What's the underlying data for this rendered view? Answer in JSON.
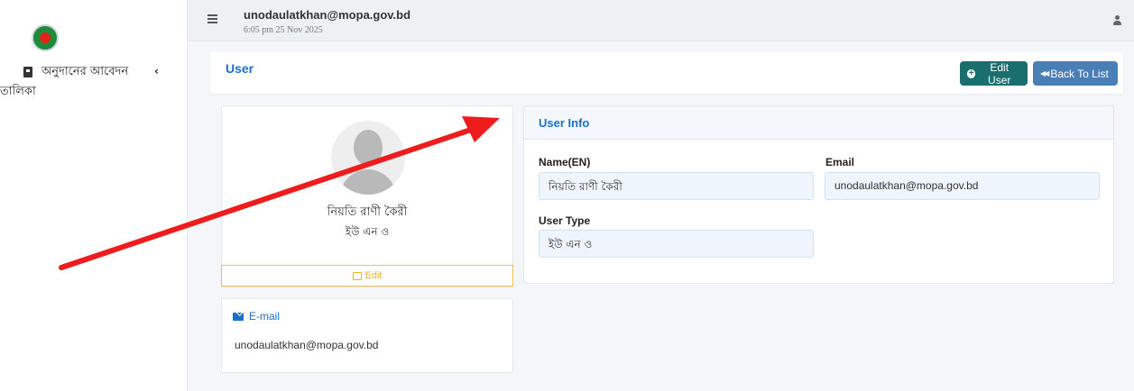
{
  "sidebar": {
    "menu_item": {
      "label_line1": "অনুদানের আবেদন",
      "label_line2": "তালিকা",
      "chevron": "‹"
    }
  },
  "topbar": {
    "user_email": "unodaulatkhan@mopa.gov.bd",
    "timestamp": "6:05 pm 25 Nov 2025"
  },
  "header": {
    "title": "User",
    "edit_user_label": "Edit User",
    "back_label": "Back To List"
  },
  "profile": {
    "name": "নিয়তি রাণী কৈরী",
    "user_type": "ইউ এন ও",
    "edit_label": "Edit"
  },
  "email_card": {
    "title": "E-mail",
    "value": "unodaulatkhan@mopa.gov.bd"
  },
  "user_info": {
    "title": "User Info",
    "name_label": "Name(EN)",
    "name_value": "নিয়তি রাণী কৈরী",
    "email_label": "Email",
    "email_value": "unodaulatkhan@mopa.gov.bd",
    "type_label": "User Type",
    "type_value": "ইউ এন ও"
  },
  "colors": {
    "accent": "#1b6fc9",
    "edit_button": "#1a6e6e",
    "back_button": "#4a7fb6",
    "warning": "#e8b21f",
    "annotation_arrow": "#ee1c1c"
  }
}
